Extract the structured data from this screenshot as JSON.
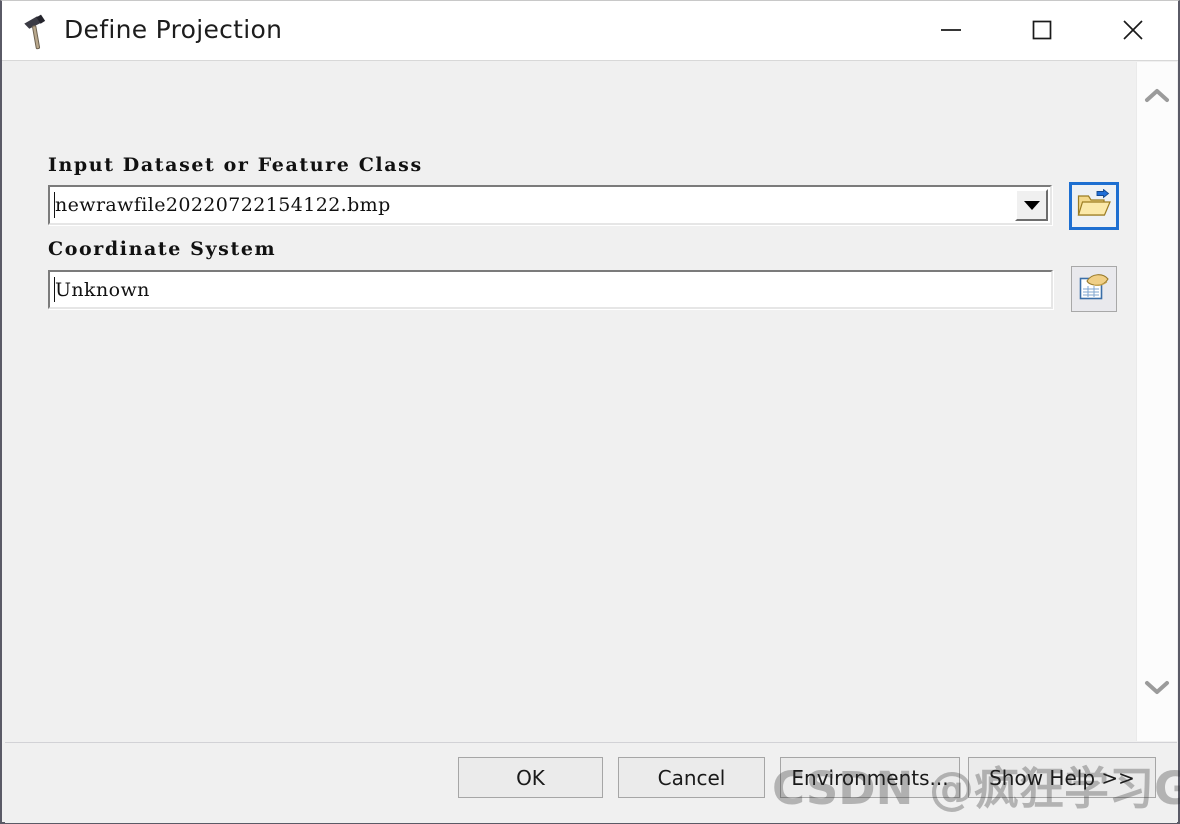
{
  "window": {
    "title": "Define Projection",
    "title_icon": "hammer-icon",
    "controls": {
      "minimize": "minimize-icon",
      "maximize": "maximize-icon",
      "close": "close-icon"
    }
  },
  "form": {
    "input_dataset": {
      "label": "Input Dataset or Feature Class",
      "value": "newrawfile20220722154122.bmp",
      "placeholder": "",
      "dropdown_icon": "chevron-down-icon",
      "browse_icon": "folder-open-icon"
    },
    "coordinate_system": {
      "label": "Coordinate System",
      "value": "Unknown",
      "placeholder": "",
      "picker_icon": "select-coordinate-system-icon"
    }
  },
  "scrollbar": {
    "up_icon": "chevron-up-icon",
    "down_icon": "chevron-down-icon"
  },
  "footer": {
    "ok_label": "OK",
    "cancel_label": "Cancel",
    "environments_label": "Environments...",
    "show_help_label": "Show Help >>"
  },
  "watermark": {
    "text": "CSDN @疯狂学习GIS"
  },
  "colors": {
    "accent": "#1d6fd1",
    "dialog_bg": "#f0f0f0",
    "titlebar_bg": "#ffffff",
    "text": "#111111",
    "button_bg": "#ebebeb"
  }
}
